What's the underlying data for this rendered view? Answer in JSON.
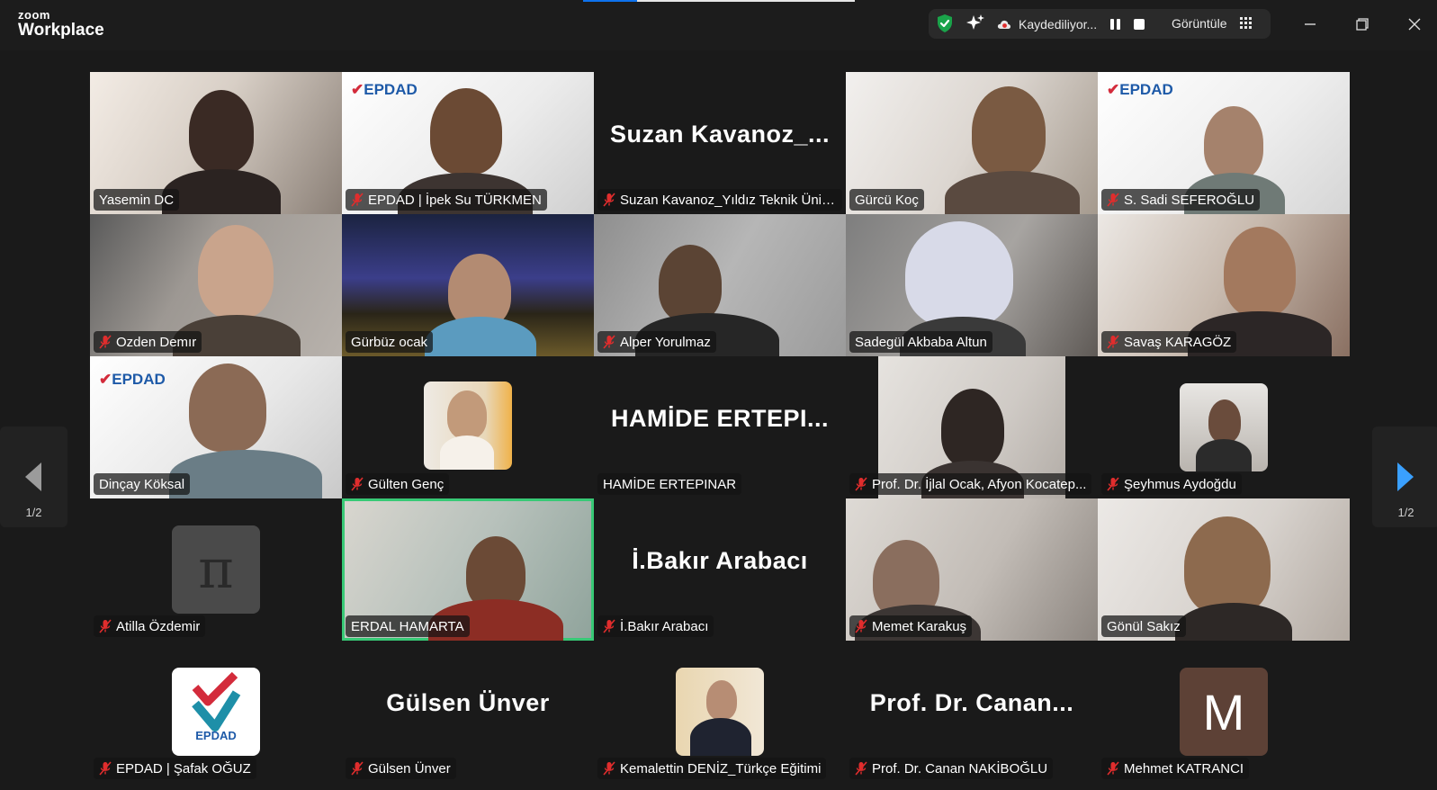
{
  "app": {
    "brand_top": "zoom",
    "brand_bottom": "Workplace"
  },
  "titlebar": {
    "recording_text": "Kaydediliyor...",
    "view_text": "Görüntüle",
    "icons": [
      "shield-check-icon",
      "ai-sparkle-icon",
      "cloud-record-icon",
      "pause-icon",
      "stop-icon",
      "grid-view-icon",
      "minimize-icon",
      "restore-icon",
      "close-icon"
    ]
  },
  "colors": {
    "accent": "#0e72ed",
    "active_speaker": "#38c976",
    "muted": "#e02d2d",
    "shield": "#1aa34a"
  },
  "pagination": {
    "left_label": "1/2",
    "right_label": "1/2"
  },
  "participants": [
    {
      "name": "Yasemin DC",
      "muted": false,
      "mode": "camera"
    },
    {
      "name": "EPDAD | İpek Su TÜRKMEN",
      "muted": true,
      "mode": "camera"
    },
    {
      "name": "Suzan Kavanoz_Yıldız Teknik Üniv...",
      "muted": true,
      "mode": "name",
      "display": "Suzan  Kavanoz_..."
    },
    {
      "name": "Gürcü Koç",
      "muted": false,
      "mode": "camera"
    },
    {
      "name": "S. Sadi SEFEROĞLU",
      "muted": true,
      "mode": "camera"
    },
    {
      "name": "Ozden Demır",
      "muted": true,
      "mode": "camera"
    },
    {
      "name": "Gürbüz ocak",
      "muted": false,
      "mode": "camera"
    },
    {
      "name": "Alper Yorulmaz",
      "muted": true,
      "mode": "camera"
    },
    {
      "name": "Sadegül Akbaba Altun",
      "muted": false,
      "mode": "camera"
    },
    {
      "name": "Savaş KARAGÖZ",
      "muted": true,
      "mode": "camera"
    },
    {
      "name": "Dinçay Köksal",
      "muted": false,
      "mode": "camera"
    },
    {
      "name": "Gülten Genç",
      "muted": true,
      "mode": "avatar"
    },
    {
      "name": "HAMİDE ERTEPINAR",
      "muted": false,
      "mode": "name",
      "display": "HAMİDE  ERTEPI..."
    },
    {
      "name": "Prof. Dr. İjlal Ocak, Afyon Kocatep...",
      "muted": true,
      "mode": "camera"
    },
    {
      "name": "Şeyhmus Aydoğdu",
      "muted": true,
      "mode": "avatar"
    },
    {
      "name": "Atilla Özdemir",
      "muted": true,
      "mode": "avatar"
    },
    {
      "name": "ERDAL HAMARTA",
      "muted": false,
      "mode": "camera",
      "active": true
    },
    {
      "name": "İ.Bakır Arabacı",
      "muted": true,
      "mode": "name",
      "display": "İ.Bakır Arabacı"
    },
    {
      "name": "Memet Karakuş",
      "muted": true,
      "mode": "camera"
    },
    {
      "name": "Gönül Sakız",
      "muted": false,
      "mode": "camera"
    },
    {
      "name": "EPDAD | Şafak OĞUZ",
      "muted": true,
      "mode": "avatar"
    },
    {
      "name": "Gülsen Ünver",
      "muted": true,
      "mode": "name",
      "display": "Gülsen Ünver"
    },
    {
      "name": "Kemalettin DENİZ_Türkçe Eğitimi",
      "muted": true,
      "mode": "avatar"
    },
    {
      "name": "Prof. Dr. Canan NAKİBOĞLU",
      "muted": true,
      "mode": "name",
      "display": "Prof.  Dr.  Canan..."
    },
    {
      "name": "Mehmet KATRANCI",
      "muted": true,
      "mode": "avatar",
      "letter": "M"
    }
  ],
  "logo_text": {
    "epdad": "EPDAD",
    "check": "✔"
  }
}
